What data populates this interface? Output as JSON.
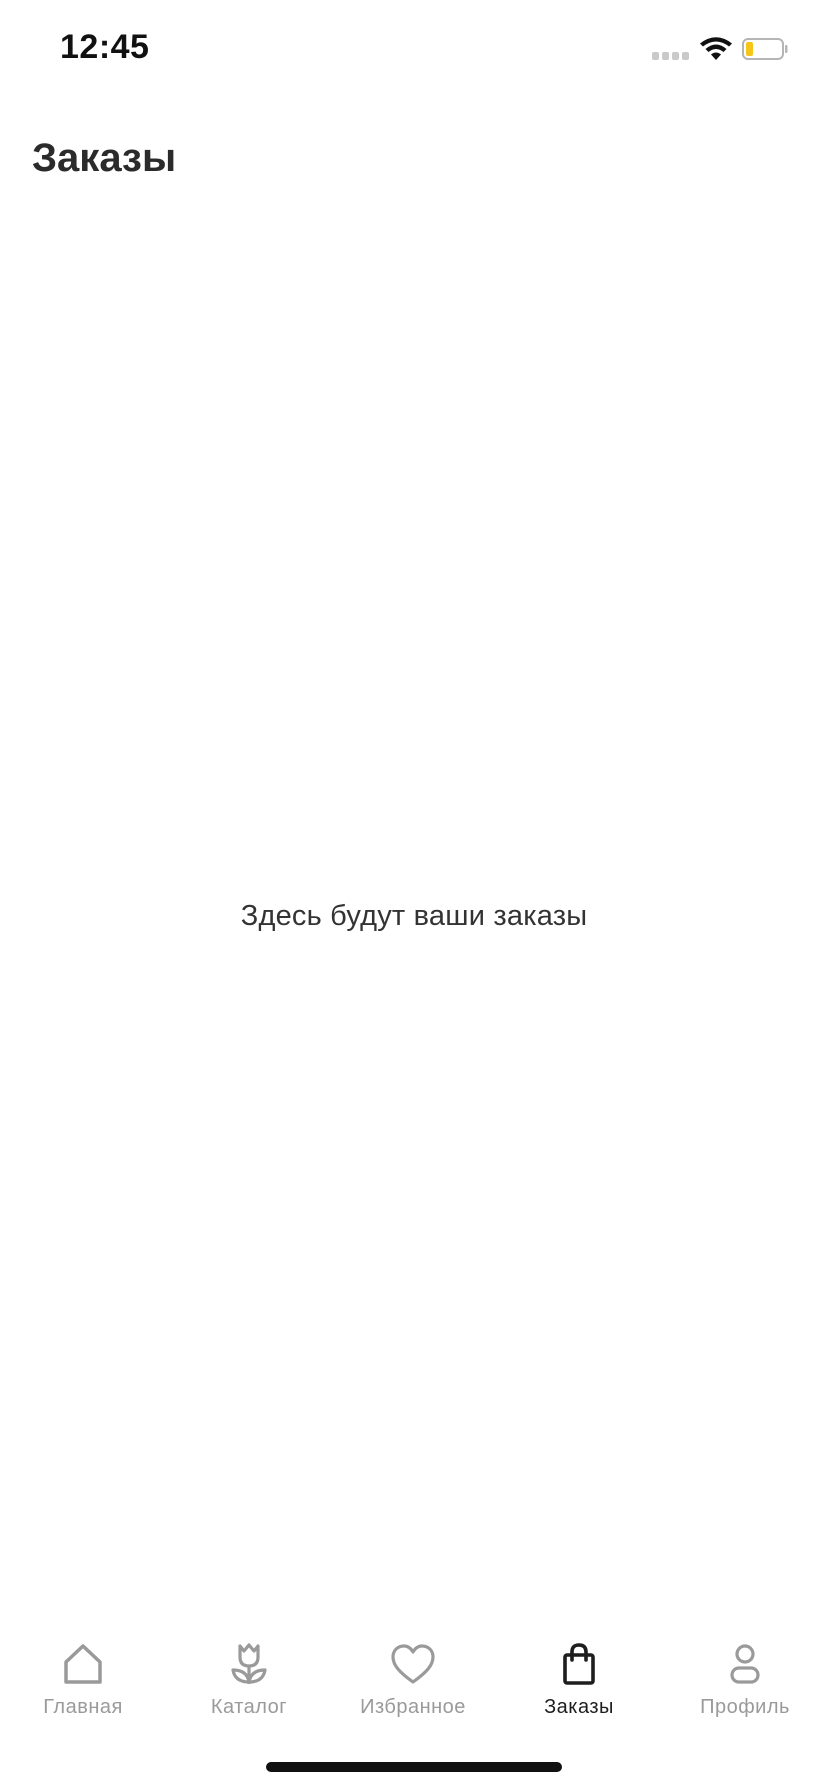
{
  "status_bar": {
    "time": "12:45",
    "battery_color": "#f5c518"
  },
  "header": {
    "title": "Заказы"
  },
  "main": {
    "empty_message": "Здесь будут ваши заказы"
  },
  "tab_bar": {
    "active_color": "#1e1e1e",
    "inactive_color": "#9a9a9a",
    "items": [
      {
        "label": "Главная",
        "icon": "home-icon",
        "active": false
      },
      {
        "label": "Каталог",
        "icon": "tulip-icon",
        "active": false
      },
      {
        "label": "Избранное",
        "icon": "heart-icon",
        "active": false
      },
      {
        "label": "Заказы",
        "icon": "shopping-bag-icon",
        "active": true
      },
      {
        "label": "Профиль",
        "icon": "profile-icon",
        "active": false
      }
    ]
  }
}
